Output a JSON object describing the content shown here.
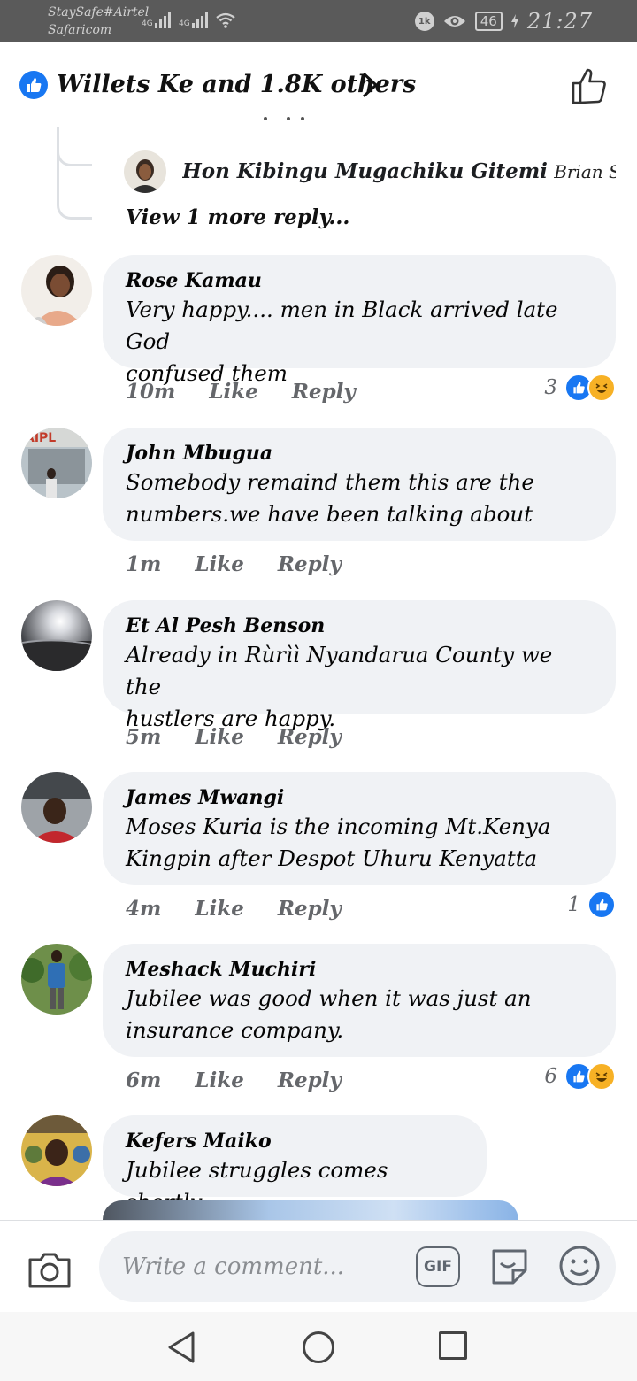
{
  "status_bar": {
    "carrier1": "StaySafe#Airtel",
    "carrier2": "Safaricom",
    "net1": "4G",
    "net2": "4G",
    "battery": "46",
    "time": "21:27"
  },
  "header": {
    "title": "Willets Ke and 1.8K others",
    "icons": [
      "like-reaction-icon",
      "chevron-right-icon",
      "thumbs-up-outline-icon"
    ]
  },
  "thread_reply": {
    "name": "Hon Kibingu Mugachiku Gitemi",
    "text": "Brian Slim �...",
    "view_more": "View 1 more reply..."
  },
  "comments": [
    {
      "name": "Rose Kamau",
      "lines": [
        "Very happy.... men in Black arrived late God",
        "confused them"
      ],
      "time": "10m",
      "like": "Like",
      "reply": "Reply",
      "reaction_count": "3",
      "reactions": [
        "like",
        "haha"
      ]
    },
    {
      "name": "John Mbugua",
      "lines": [
        "Somebody remaind them this are the",
        "numbers.we have been talking about"
      ],
      "time": "1m",
      "like": "Like",
      "reply": "Reply",
      "reaction_count": "",
      "reactions": []
    },
    {
      "name": "Et Al Pesh Benson",
      "lines": [
        "Already in Rùrìì Nyandarua County we the",
        "hustlers are happy."
      ],
      "time": "5m",
      "like": "Like",
      "reply": "Reply",
      "reaction_count": "",
      "reactions": []
    },
    {
      "name": "James Mwangi",
      "lines": [
        "Moses Kuria is the incoming Mt.Kenya",
        "Kingpin after Despot Uhuru Kenyatta"
      ],
      "time": "4m",
      "like": "Like",
      "reply": "Reply",
      "reaction_count": "1",
      "reactions": [
        "like"
      ]
    },
    {
      "name": "Meshack Muchiri",
      "lines": [
        "Jubilee was good when it was just an",
        "insurance company."
      ],
      "time": "6m",
      "like": "Like",
      "reply": "Reply",
      "reaction_count": "6",
      "reactions": [
        "like",
        "haha"
      ]
    },
    {
      "name": "Kefers Maiko",
      "lines": [
        "Jubilee struggles comes shortly"
      ],
      "time": "",
      "like": "",
      "reply": "",
      "reaction_count": "",
      "reactions": []
    }
  ],
  "composer": {
    "placeholder": "Write a comment...",
    "gif_label": "GIF"
  },
  "colors": {
    "facebook_blue": "#1877f2",
    "bubble_bg": "#f0f2f5",
    "meta_gray": "#65676b",
    "haha_yellow": "#f7b125"
  }
}
